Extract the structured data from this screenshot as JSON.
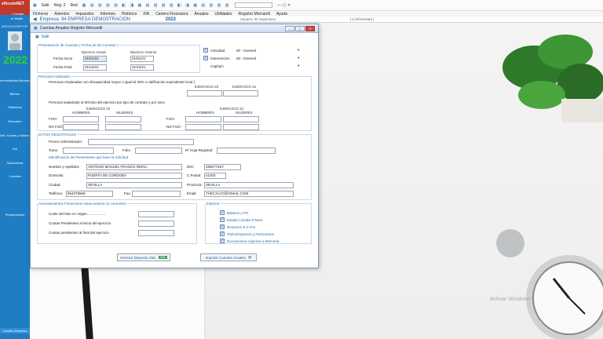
{
  "app": {
    "title": "eficcoteNET",
    "year": "2022",
    "option_ocultar": "Ocultar",
    "option_visible": "Visible",
    "user_block": "AREA SUSCRIPTOR",
    "sidebar_items": [
      "Inmovilizado/Amortizaciones",
      "Bienes",
      "Históricos",
      "Resumen",
      "Bal. Sumas y Saldos",
      "IVA",
      "Subcuentas",
      "Cuentas",
      "Presupuestos",
      "Cambio Empresa"
    ]
  },
  "toolbar": {
    "salir": "Salir",
    "reg": "Reg: 2",
    "red": "Red"
  },
  "menu": [
    "Ficheros",
    "Asientos",
    "Impuestos",
    "Informes",
    "Histórico",
    "IVA",
    "Cartera Financiera",
    "Anuales",
    "Utilidades",
    "Registro Mercantil",
    "Ayuda"
  ],
  "empresa_bar": {
    "empresa": "Empresa: 94  EMPRESA DEMOSTRACION",
    "year": "2022",
    "usuario": "Usuario: 00  Supervisor",
    "extra": "| Conformidad |"
  },
  "window": {
    "title": "Cuentas Anuales Registro Mercantil",
    "salir": "Salir",
    "presentacion": {
      "legend": "Presentación de Cuentas ( Fecha de las Cuentas )",
      "ej_actual": "Ejercicio Actual",
      "ej_anterior": "Ejercicio Anterior",
      "fecha_inicio_label": "Fecha Inicio",
      "fecha_final_label": "Fecha Final",
      "inicio_actual": "01/01/22",
      "final_actual": "31/12/22",
      "inicio_anterior": "01/01/21",
      "final_anterior": "31/12/21",
      "actividad_label": "Actividad",
      "actividad_value": "00 - General",
      "intervencion_label": "Intervención",
      "intervencion_value": "00 - General",
      "capitulo_label": "Capítulo"
    },
    "personal": {
      "legend": "Personal Asalariado",
      "discapacidad_text": "Personas empleadas con discapacidad mayor o igual al 33% o calificación equivalente local )",
      "ejercicio22": "EJERCICIO 22",
      "ejercicio21": "EJERCICIO 21",
      "tipo_contrato_text": "Personal asalariado al término del ejercicio por tipo de contrato y por sexo",
      "hombres": "HOMBRES",
      "mujeres": "MUJERES",
      "fijo": "FIJO:",
      "no_fijo": "NO FIJO:"
    },
    "datos_registrales": {
      "legend": "DATOS REGISTRALES",
      "primer_admin": "Primer Administrador:",
      "tomo": "Tomo:",
      "folio": "Folio:",
      "hoja": "Nº Hoja Registral:",
      "ident_legend": "Identificación del Presentante que hace la solicitud",
      "nombre_label": "Nombre y Apellidos",
      "nombre_value": "ANTONIO MANUEL FRANCO REINA",
      "dni_label": "DNI:",
      "dni_value": "28507746Y",
      "domicilio_label": "Domicilio:",
      "domicilio_value": "PUERTA DE CORDOBA",
      "cpostal_label": "C.Postal:",
      "cpostal_value": "41003",
      "ciudad_label": "Ciudad:",
      "ciudad_value": "SEVILLA",
      "provincia_label": "Provincia:",
      "provincia_value": "SEVILLA",
      "telefono_label": "Teléfono:",
      "telefono_value": "954379669",
      "fax_label": "Fax:",
      "email_label": "Email:",
      "email_value": "THECALVO@GMAIL.COM"
    },
    "arrendamientos": {
      "legend": "Arrendamientos Financieros sobre activos no corrientes",
      "coste": "Coste del bien en origen...................",
      "pendientes_inicio": "Cuotas Pendientes al inicio del ejercicio",
      "pendientes_final": "Cuotas pendientes al final del ejercicio"
    },
    "imprimir": {
      "legend": "Imprimir",
      "items": [
        "Balance y PG",
        "Estado Cambio P.Neto",
        "Resumen E.C.P.N",
        "Titulos/Ingresos y Particulares",
        "Documentos Adjuntos a Memoria"
      ]
    },
    "btn_xml": "Generar Deposito XML",
    "btn_xml_badge": "XML",
    "btn_imprimir": "Imprimir Cuentas Anuales"
  },
  "watermark": "Activar Windows"
}
